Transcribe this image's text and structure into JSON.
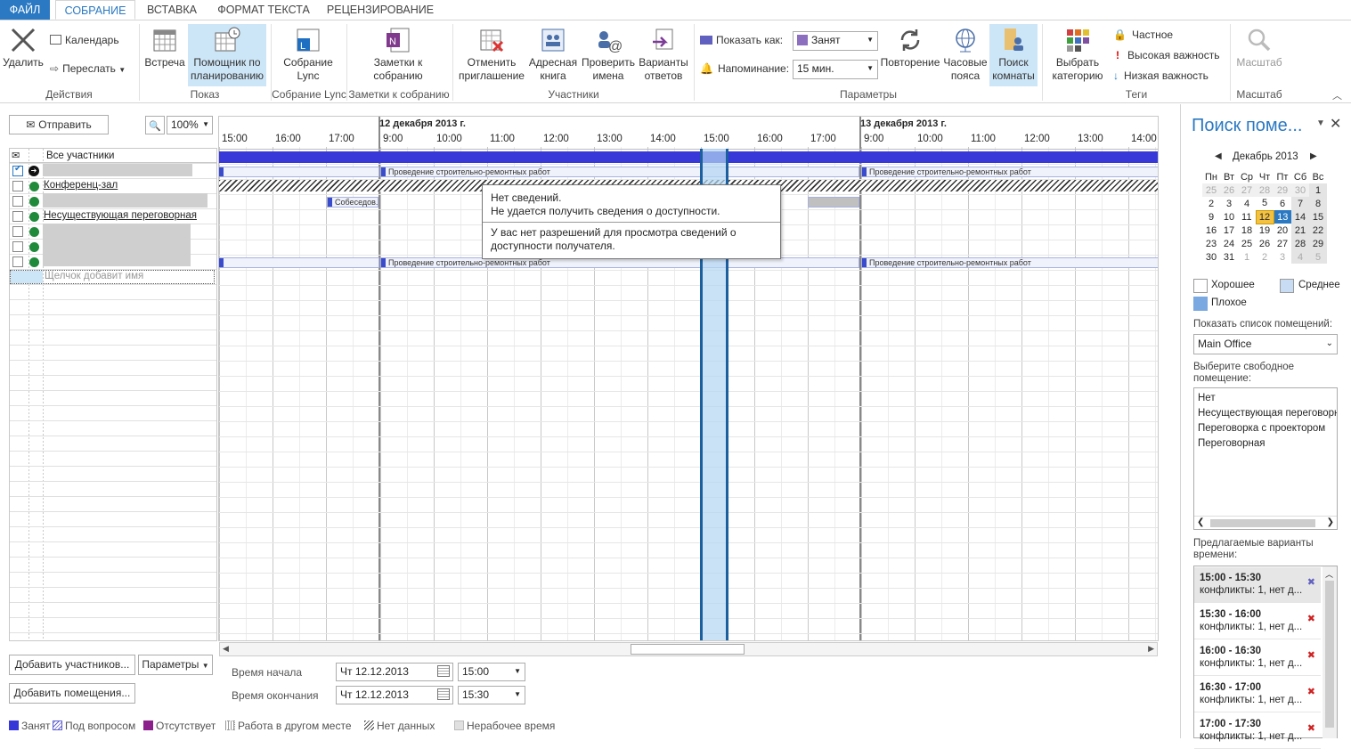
{
  "tabs": [
    "ФАЙЛ",
    "СОБРАНИЕ",
    "ВСТАВКА",
    "ФОРМАТ ТЕКСТА",
    "РЕЦЕНЗИРОВАНИЕ"
  ],
  "ribbon": {
    "delete": "Удалить",
    "calendar": "Календарь",
    "forward": "Переслать",
    "meeting": "Встреча",
    "assistant": "Помощник по планированию",
    "lync": "Собрание Lync",
    "notes": "Заметки к собранию",
    "cancel": "Отменить приглашение",
    "address": "Адресная книга",
    "check": "Проверить имена",
    "responses": "Варианты ответов",
    "show_as_label": "Показать как:",
    "show_as_value": "Занят",
    "reminder_label": "Напоминание:",
    "reminder_value": "15 мин.",
    "recurrence": "Повторение",
    "timezones": "Часовые пояса",
    "room_finder": "Поиск комнаты",
    "category": "Выбрать категорию",
    "private": "Частное",
    "high": "Высокая важность",
    "low": "Низкая важность",
    "zoom": "Масштаб",
    "groups": [
      "Действия",
      "Показ",
      "Собрание Lync",
      "Заметки к собранию",
      "Участники",
      "Параметры",
      "Теги",
      "Масштаб"
    ]
  },
  "left": {
    "send": "Отправить",
    "zoom": "100%",
    "all": "Все участники",
    "conf": "Конференц-зал",
    "noexist": "Несуществующая переговорная",
    "add_name": "Щелчок добавит имя",
    "add_attendees": "Добавить участников...",
    "options": "Параметры",
    "add_rooms": "Добавить помещения..."
  },
  "grid": {
    "day1": "12 декабря 2013 г.",
    "day2": "13 декабря 2013 г.",
    "hours1": [
      "15:00",
      "16:00",
      "17:00"
    ],
    "hours2": [
      "9:00",
      "10:00",
      "11:00",
      "12:00",
      "13:00",
      "14:00",
      "15:00",
      "16:00",
      "17:00"
    ],
    "hours3": [
      "9:00",
      "10:00",
      "11:00",
      "12:00",
      "13:00",
      "14:00"
    ],
    "event": "Проведение строительно-ремонтных работ",
    "interview": "Собеседов..."
  },
  "tooltip": {
    "l1": "Нет сведений.",
    "l2": "Не удается получить сведения о доступности.",
    "l3": "У вас нет разрешений для просмотра сведений о",
    "l4": "доступности получателя."
  },
  "times": {
    "start_label": "Время начала",
    "end_label": "Время окончания",
    "start_date": "Чт 12.12.2013",
    "start_time": "15:00",
    "end_date": "Чт 12.12.2013",
    "end_time": "15:30"
  },
  "legend": [
    "Занят",
    "Под вопросом",
    "Отсутствует",
    "Работа в другом месте",
    "Нет данных",
    "Нерабочее время"
  ],
  "pane": {
    "title": "Поиск поме...",
    "month": "Декабрь 2013",
    "wd": [
      "Пн",
      "Вт",
      "Ср",
      "Чт",
      "Пт",
      "Сб",
      "Вс"
    ],
    "weeks": [
      [
        "25",
        "26",
        "27",
        "28",
        "29",
        "30",
        "1"
      ],
      [
        "2",
        "3",
        "4",
        "5",
        "6",
        "7",
        "8"
      ],
      [
        "9",
        "10",
        "11",
        "12",
        "13",
        "14",
        "15"
      ],
      [
        "16",
        "17",
        "18",
        "19",
        "20",
        "21",
        "22"
      ],
      [
        "23",
        "24",
        "25",
        "26",
        "27",
        "28",
        "29"
      ],
      [
        "30",
        "31",
        "1",
        "2",
        "3",
        "4",
        "5"
      ]
    ],
    "good": "Хорошее",
    "medium": "Среднее",
    "bad": "Плохое",
    "show_list": "Показать список помещений:",
    "office": "Main Office",
    "choose": "Выберите свободное помещение:",
    "rooms": [
      "Нет",
      "Несуществующая переговорн",
      "Переговорка с проектором",
      "Переговорная"
    ],
    "suggest": "Предлагаемые варианты времени:",
    "slots": [
      {
        "t": "15:00 - 15:30",
        "c": "конфликты: 1, нет д..."
      },
      {
        "t": "15:30 - 16:00",
        "c": "конфликты: 1, нет д..."
      },
      {
        "t": "16:00 - 16:30",
        "c": "конфликты: 1, нет д..."
      },
      {
        "t": "16:30 - 17:00",
        "c": "конфликты: 1, нет д..."
      },
      {
        "t": "17:00 - 17:30",
        "c": "конфликты: 1, нет д..."
      }
    ]
  }
}
